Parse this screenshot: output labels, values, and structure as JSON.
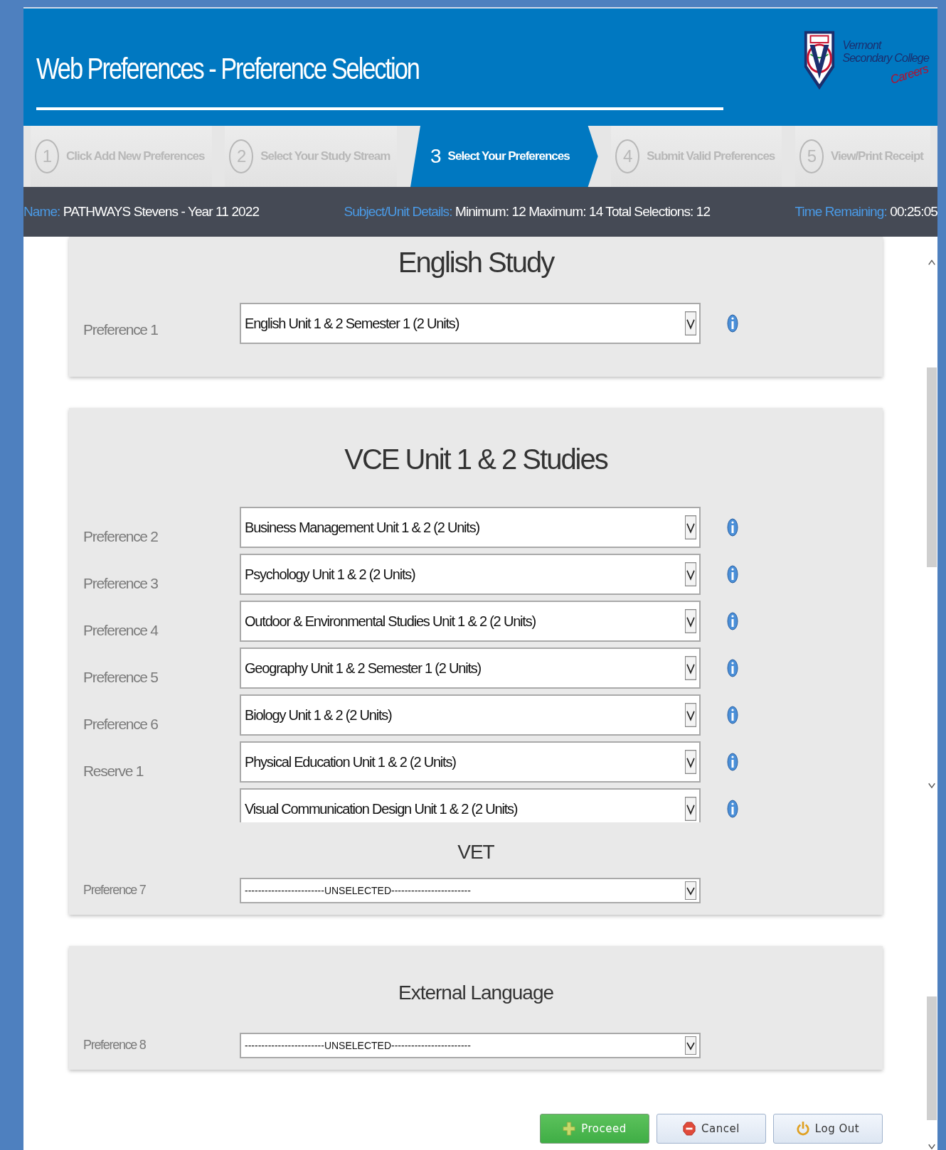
{
  "header": {
    "title": "Web Preferences - Preference Selection",
    "logo": {
      "line_1": "Vermont",
      "line_2": "Secondary College",
      "tagline": "Careers"
    }
  },
  "steps": [
    {
      "number": "1",
      "label": "Click Add New Preferences",
      "selected": false
    },
    {
      "number": "2",
      "label": "Select Your Study Stream",
      "selected": false
    },
    {
      "number": "3",
      "label": "Select Your Preferences",
      "selected": true
    },
    {
      "number": "4",
      "label": "Submit Valid Preferences",
      "selected": false
    },
    {
      "number": "5",
      "label": "View/Print Receipt",
      "selected": false
    }
  ],
  "info_bar": {
    "name_label": "Name:",
    "name_value": "PATHWAYS Stevens - Year 11 2022",
    "details_label": "Subject/Unit Details:",
    "details_value": "Minimum: 12 Maximum: 14 Total Selections: 12",
    "time_label": "Time Remaining:",
    "time_value": "00:25:05"
  },
  "cards": [
    {
      "groups": [
        {
          "title": "English Study",
          "kind": "list",
          "rows": [
            {
              "label": "Preference 1",
              "value": "English Unit 1 & 2 Semester 1 (2 Units)",
              "info_button": true
            }
          ]
        }
      ]
    },
    {
      "groups": [
        {
          "title": "VCE Unit 1 & 2 Studies",
          "kind": "scroll-list",
          "rows": [
            {
              "label": "Preference 2",
              "value": "Business Management Unit 1 & 2 (2 Units)",
              "info_button": true
            },
            {
              "label": "Preference 3",
              "value": "Psychology Unit 1 & 2 (2 Units)",
              "info_button": true
            },
            {
              "label": "Preference 4",
              "value": "Outdoor & Environmental Studies Unit 1 & 2 (2 Units)",
              "info_button": true
            },
            {
              "label": "Preference 5",
              "value": "Geography Unit 1 & 2 Semester 1 (2 Units)",
              "info_button": true
            },
            {
              "label": "Preference 6",
              "value": "Biology Unit 1 & 2 (2 Units)",
              "info_button": true
            },
            {
              "label": "Reserve 1",
              "value": "Physical Education Unit 1 & 2 (2 Units)",
              "info_button": true
            },
            {
              "value": "Visual Communication Design Unit 1 & 2 (2 Units)",
              "info_button": true
            }
          ]
        },
        {
          "title": "VET",
          "kind": "list",
          "rows": [
            {
              "label": "Preference 7",
              "value": "------------------------UNSELECTED------------------------",
              "info_button": false
            }
          ]
        }
      ]
    },
    {
      "groups": [
        {
          "title": "External Language",
          "kind": "list",
          "rows": [
            {
              "label": "Preference 8",
              "value": "------------------------UNSELECTED------------------------",
              "info_button": false
            }
          ]
        }
      ]
    }
  ],
  "buttons": [
    {
      "label": "Proceed",
      "kind": "proceed"
    },
    {
      "label": "Cancel",
      "kind": "cancel"
    },
    {
      "label": "Log Out",
      "kind": "logout"
    }
  ]
}
